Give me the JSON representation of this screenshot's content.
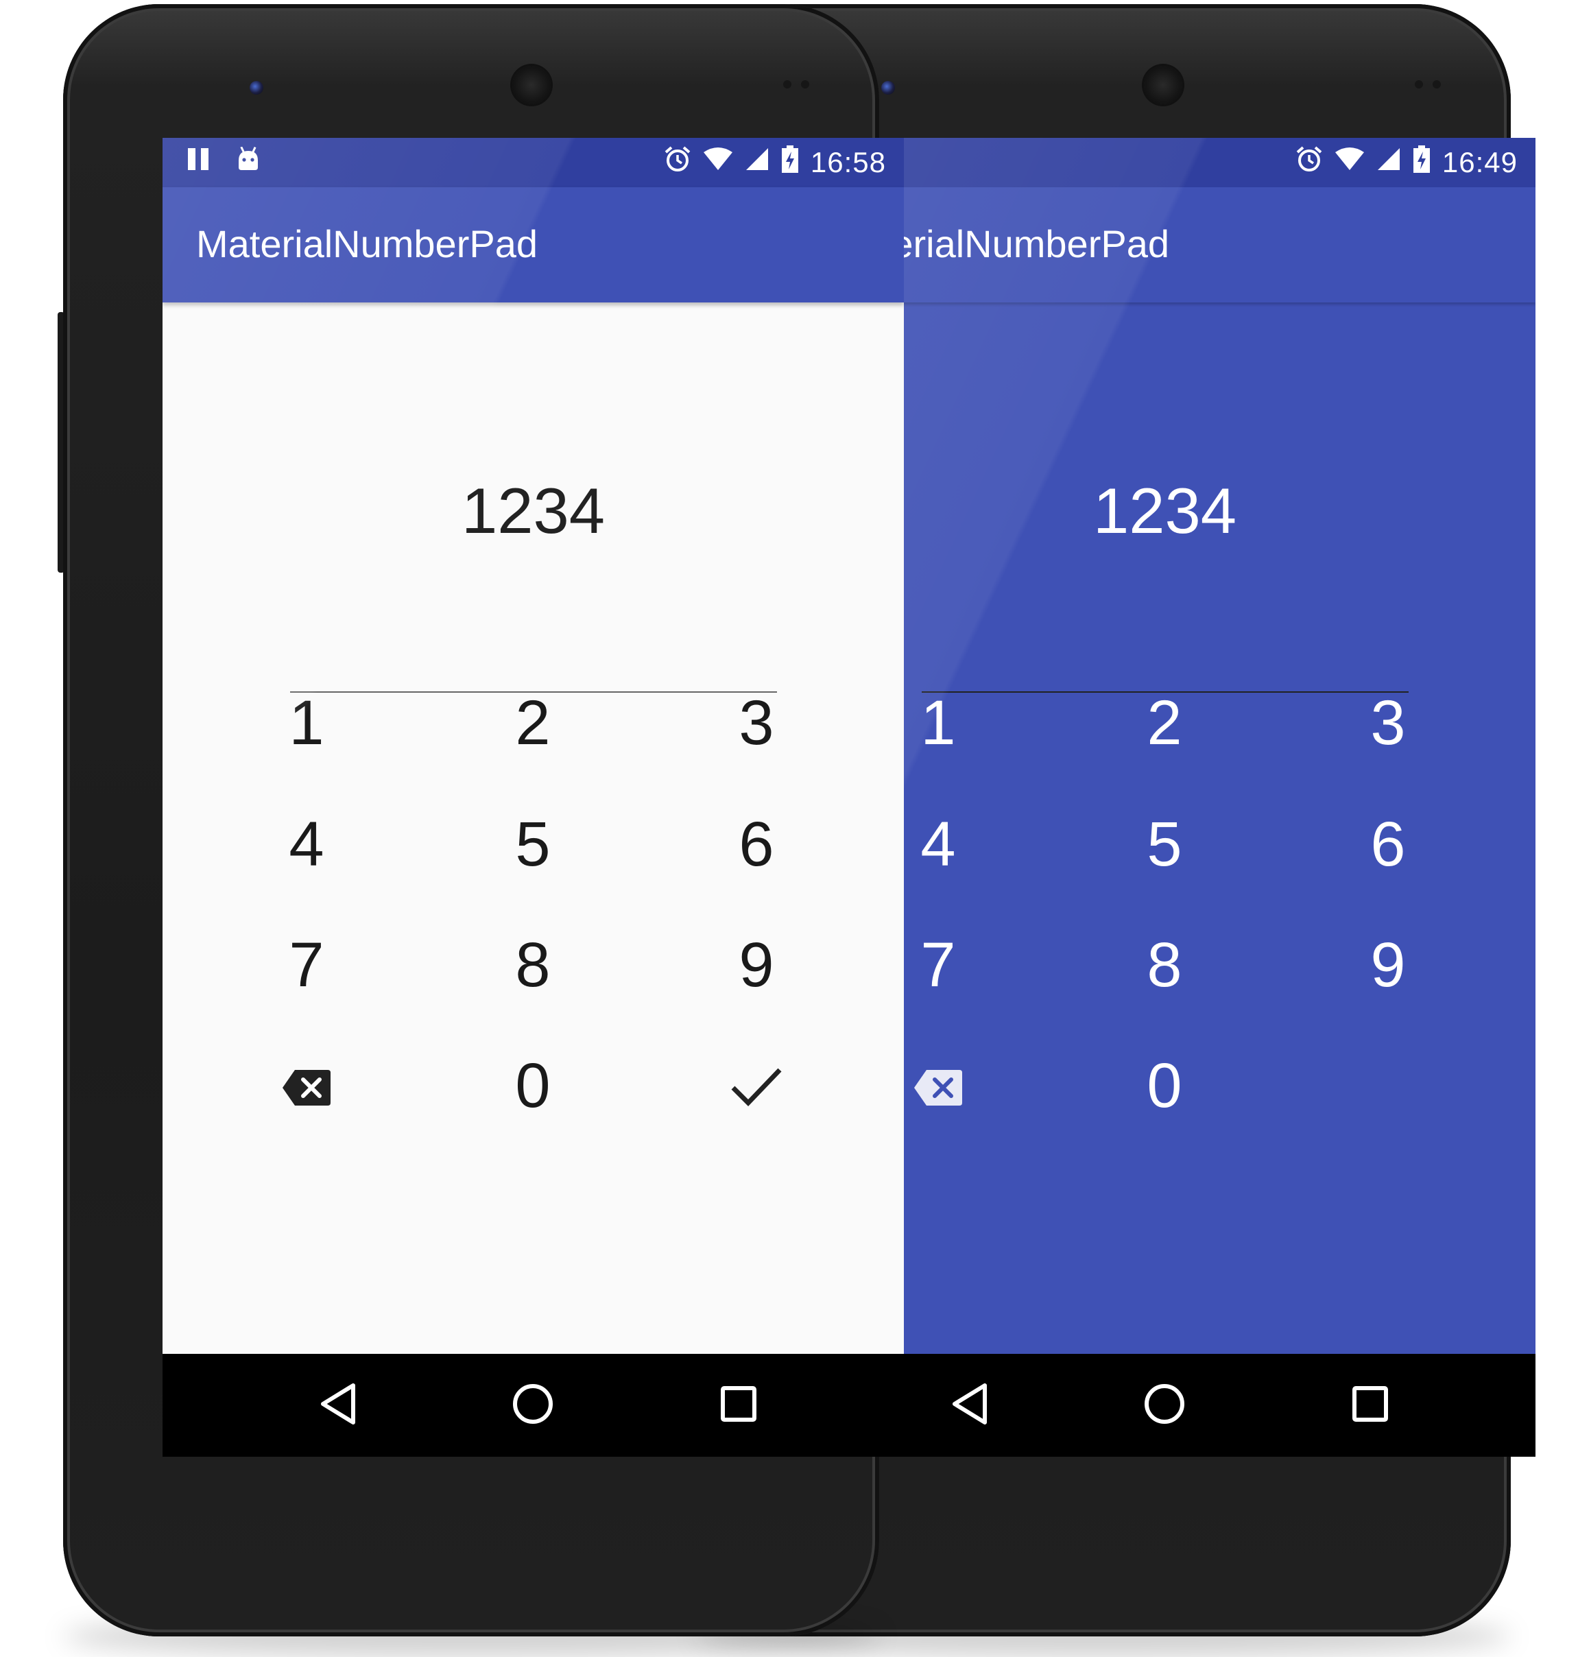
{
  "phones": [
    {
      "theme": "light",
      "status_time": "16:58",
      "app_title": "MaterialNumberPad",
      "input_value": "1234",
      "keys": [
        "1",
        "2",
        "3",
        "4",
        "5",
        "6",
        "7",
        "8",
        "9",
        "0"
      ],
      "backspace_icon": "backspace-icon",
      "confirm_icon": "check-icon"
    },
    {
      "theme": "blue",
      "status_time": "16:49",
      "app_title": "MaterialNumberPad",
      "input_value": "1234",
      "keys": [
        "1",
        "2",
        "3",
        "4",
        "5",
        "6",
        "7",
        "8",
        "9",
        "0"
      ],
      "backspace_icon": "backspace-icon"
    }
  ],
  "nav_icons": [
    "back-icon",
    "home-icon",
    "recents-icon"
  ],
  "colors": {
    "status_bar": "#303f9f",
    "app_bar": "#3f51b5",
    "light_background": "#fafafa",
    "nav_bar": "#000000",
    "text_dark": "#1a1a1a",
    "text_light": "#ffffff"
  }
}
